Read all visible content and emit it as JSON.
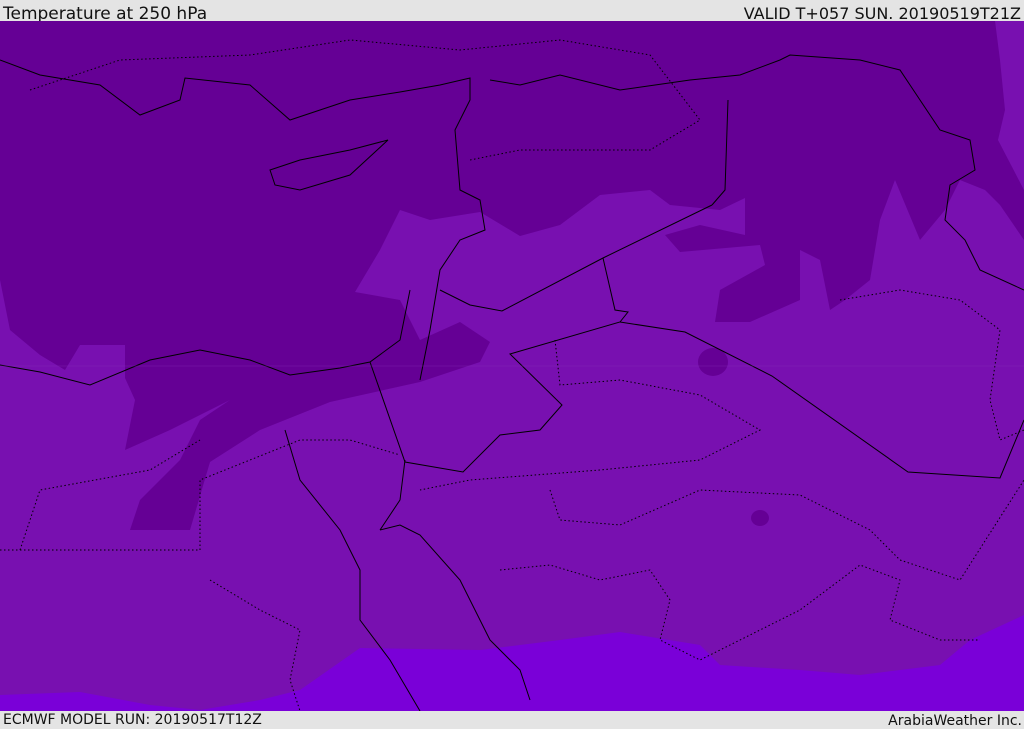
{
  "header": {
    "title": "Temperature at 250 hPa",
    "valid": "VALID T+057 SUN. 20190519T21Z"
  },
  "footer": {
    "model_run": "ECMWF MODEL RUN: 20190517T12Z",
    "credit": "ArabiaWeather Inc."
  },
  "colors": {
    "dark_band": "#650095",
    "mid_band": "#7810b0",
    "light_band": "#7a00d8",
    "border": "#000000"
  }
}
